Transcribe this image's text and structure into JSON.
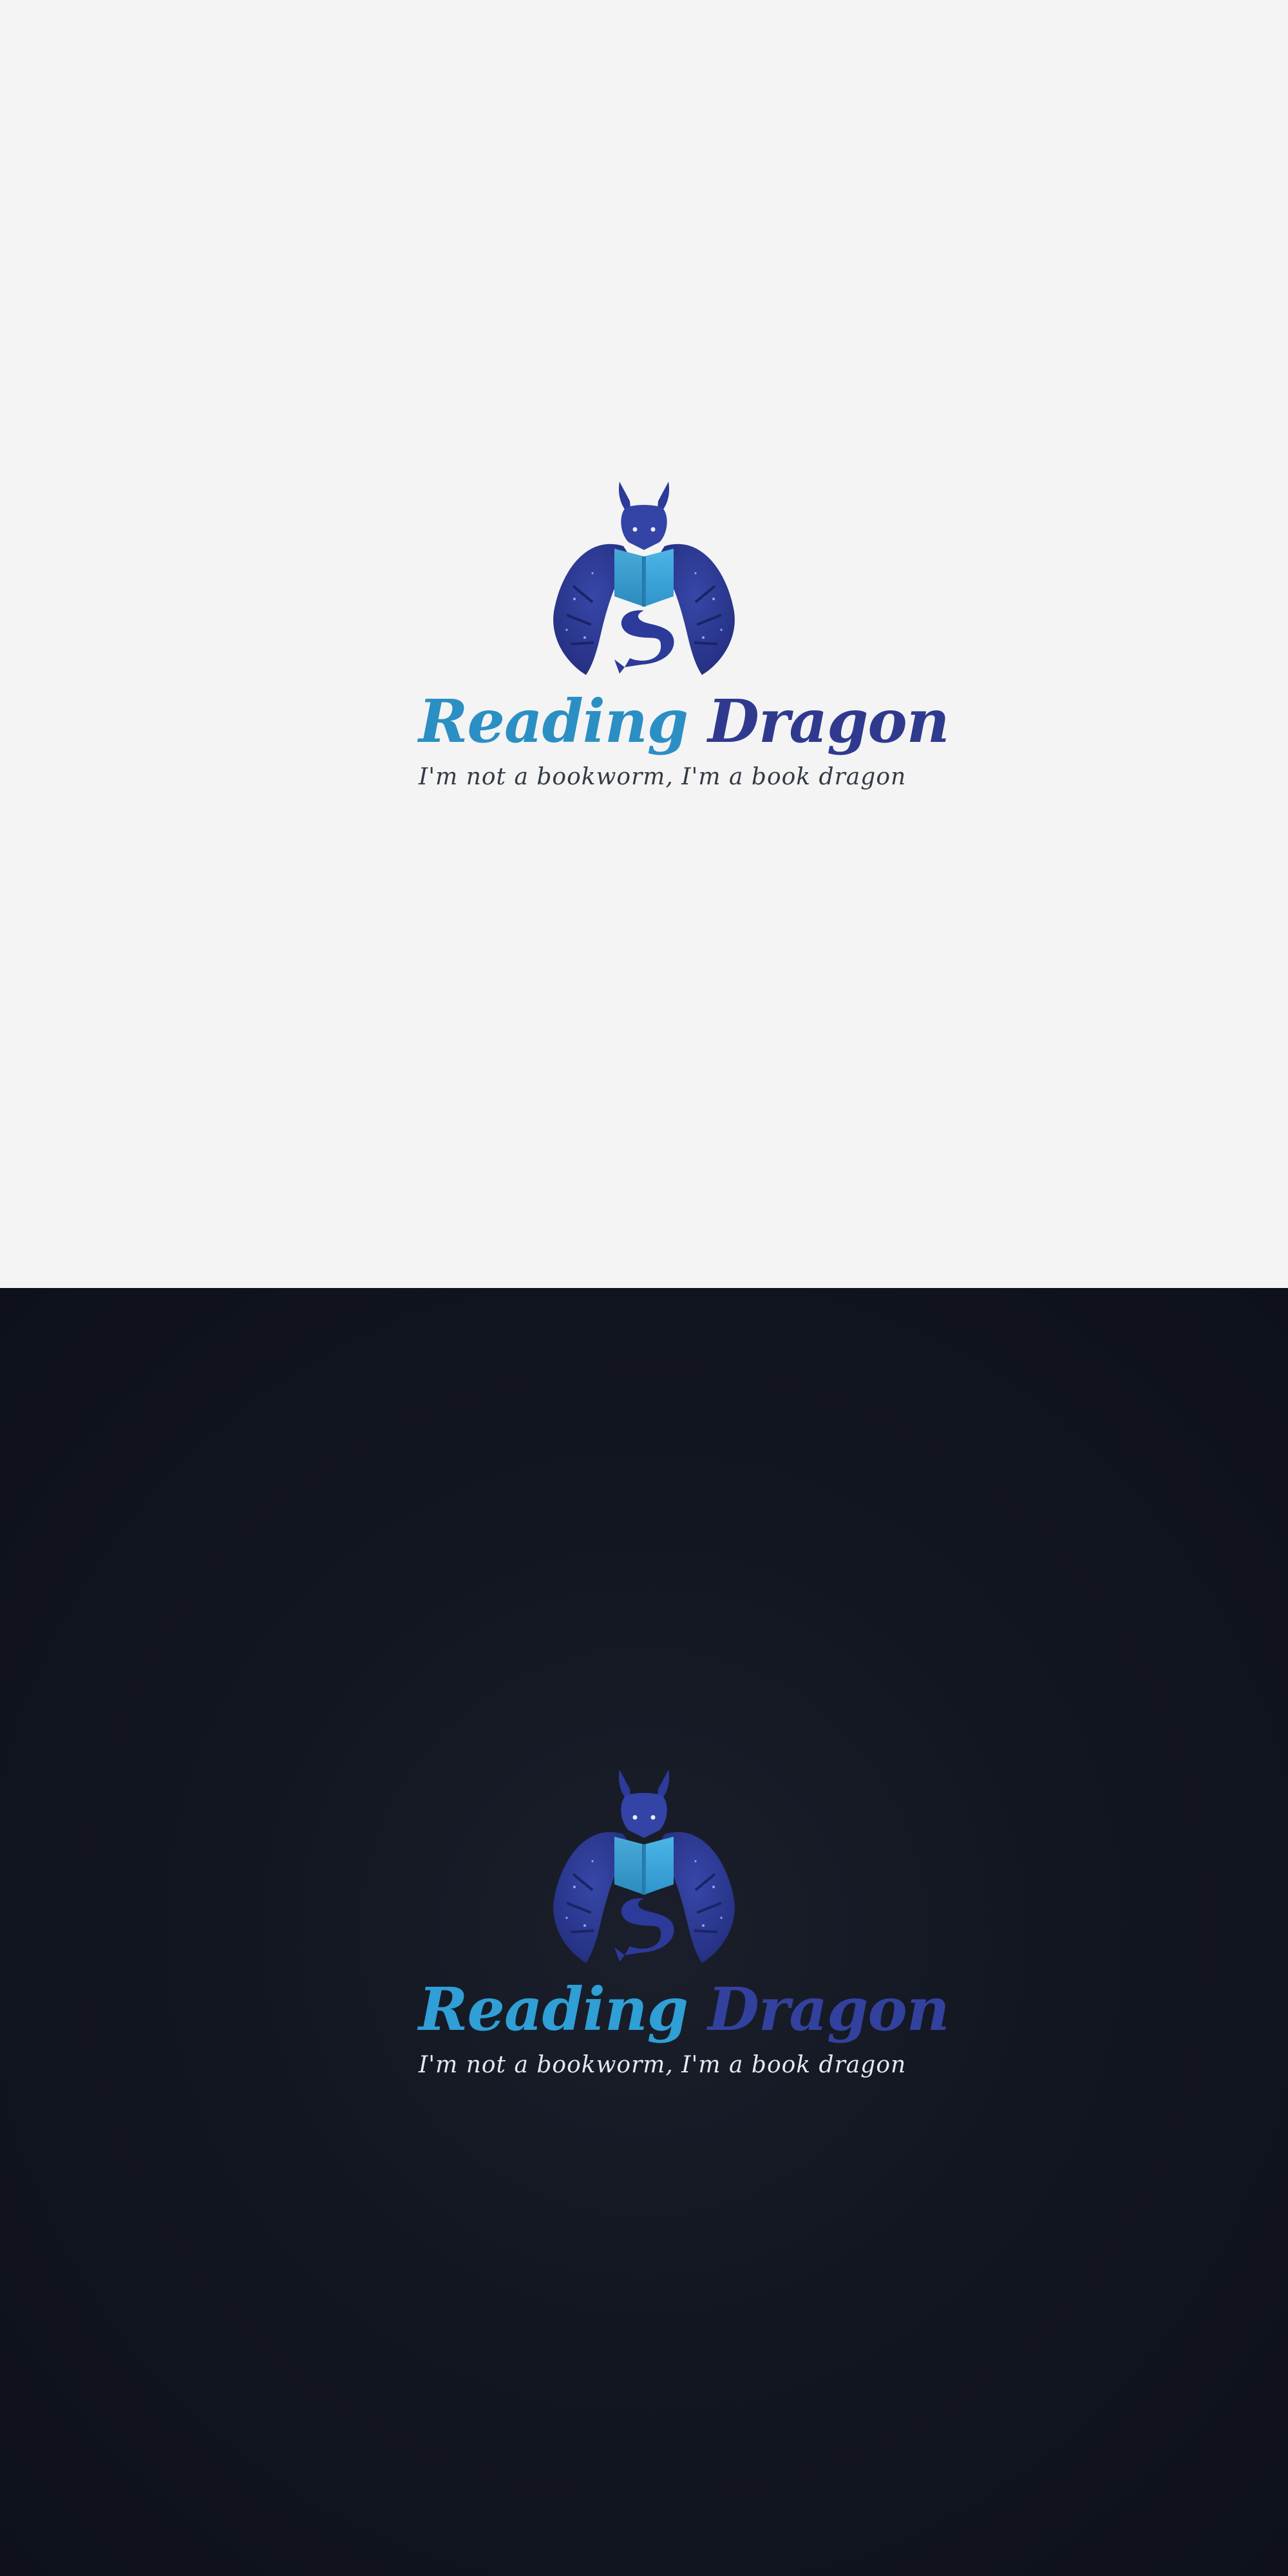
{
  "panels": [
    {
      "theme": "light",
      "background": "#f4f4f4",
      "logo": {
        "emblem_icon": "dragon-reading-book-icon",
        "wordmark": [
          "Reading",
          "Dragon"
        ],
        "tagline": "I'm not a bookworm, I'm a book dragon"
      }
    },
    {
      "theme": "dark",
      "background": "#121620",
      "logo": {
        "emblem_icon": "dragon-reading-book-icon",
        "wordmark": [
          "Reading",
          "Dragon"
        ],
        "tagline": "I'm not a bookworm, I'm a book dragon"
      }
    }
  ],
  "colors": {
    "wordmark_primary": "#2b8fc4",
    "wordmark_secondary": "#2f3a8f",
    "dragon_body": "#2c3a9a",
    "book": "#3aa7dc"
  }
}
